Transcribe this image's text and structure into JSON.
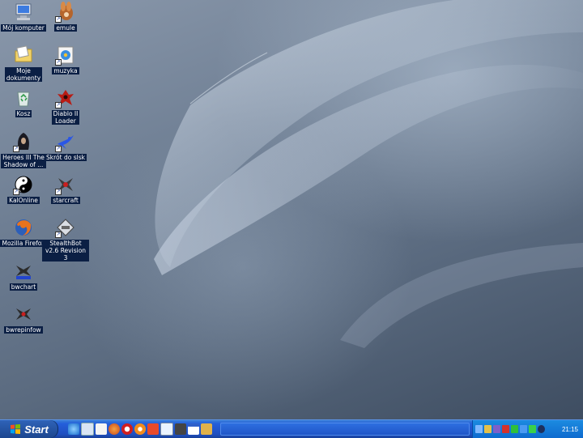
{
  "desktop": {
    "icons": [
      {
        "label": "Mój komputer",
        "icon": "computer-icon"
      },
      {
        "label": "emule",
        "icon": "emule-icon"
      },
      {
        "label": "Moje\ndokumenty",
        "icon": "folder-icon"
      },
      {
        "label": "muzyka",
        "icon": "media-icon"
      },
      {
        "label": "Kosz",
        "icon": "recycle-bin-icon"
      },
      {
        "label": "Diablo II\nLoader",
        "icon": "diablo-icon"
      },
      {
        "label": "Heroes III The\nShadow of ...",
        "icon": "heroes-icon"
      },
      {
        "label": "Skrót do slsk",
        "icon": "soulseek-icon"
      },
      {
        "label": "KalOnline",
        "icon": "yin-yang-icon"
      },
      {
        "label": "starcraft",
        "icon": "starcraft-icon"
      },
      {
        "label": "Mozilla Firefox",
        "icon": "firefox-icon"
      },
      {
        "label": "StealthBot\nv2.6 Revision 3",
        "icon": "stealthbot-icon"
      },
      {
        "label": "bwchart",
        "icon": "bwchart-icon"
      },
      {
        "label": "bwrepinfow",
        "icon": "bwrepinfo-icon"
      }
    ]
  },
  "taskbar": {
    "start_label": "Start",
    "clock": "21:15"
  },
  "colors": {
    "taskbar": "#245edb",
    "label_bg": "#0b1f44",
    "tray": "#0e6bcf"
  }
}
